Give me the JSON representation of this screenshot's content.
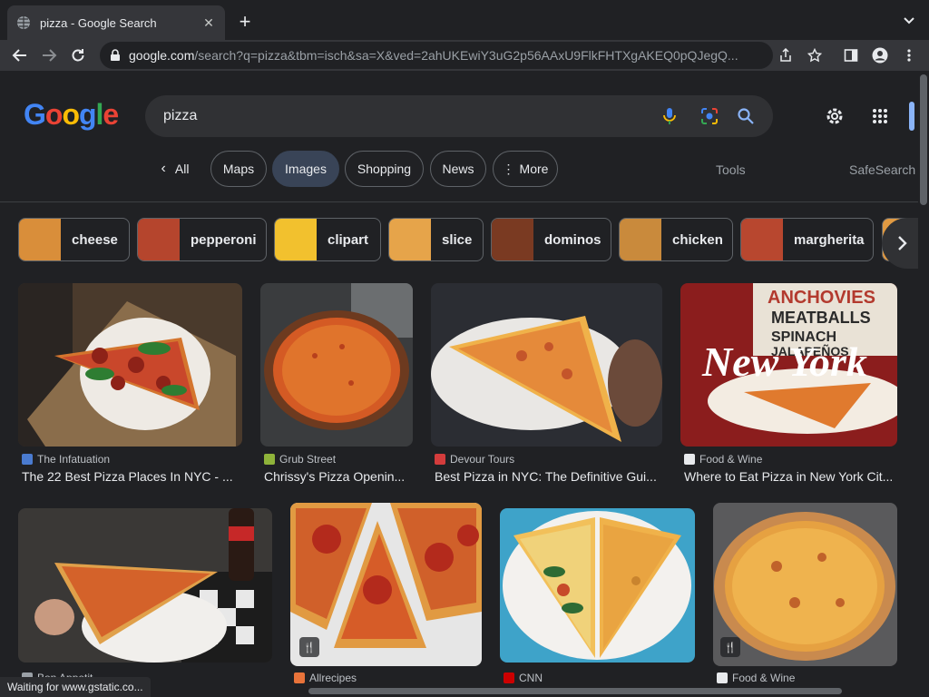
{
  "browser": {
    "tab_title": "pizza - Google Search",
    "url_host": "google.com",
    "url_path": "/search?q=pizza&tbm=isch&sa=X&ved=2ahUKEwiY3uG2p56AAxU9FlkFHTXgAKEQ0pQJegQ..."
  },
  "google": {
    "logo_letters": [
      "G",
      "o",
      "o",
      "g",
      "l",
      "e"
    ],
    "query": "pizza"
  },
  "nav": {
    "all": "All",
    "maps": "Maps",
    "images": "Images",
    "shopping": "Shopping",
    "news": "News",
    "more": "More",
    "tools": "Tools",
    "safesearch": "SafeSearch"
  },
  "related": [
    {
      "label": "cheese",
      "thumb": "#d98e3a"
    },
    {
      "label": "pepperoni",
      "thumb": "#b5452d"
    },
    {
      "label": "clipart",
      "thumb": "#f2c12e"
    },
    {
      "label": "slice",
      "thumb": "#e6a44a"
    },
    {
      "label": "dominos",
      "thumb": "#7a3a22"
    },
    {
      "label": "chicken",
      "thumb": "#c98a3c"
    },
    {
      "label": "margherita",
      "thumb": "#b8472f"
    }
  ],
  "results": [
    {
      "source": "The Infatuation",
      "title": "The 22 Best Pizza Places In NYC - ...",
      "fav": "#4a7bd0"
    },
    {
      "source": "Grub Street",
      "title": "Chrissy's Pizza Openin...",
      "fav": "#8fb33a"
    },
    {
      "source": "Devour Tours",
      "title": "Best Pizza in NYC: The Definitive Gui...",
      "fav": "#d43c3c"
    },
    {
      "source": "Food & Wine",
      "title": "Where to Eat Pizza in New York Cit...",
      "fav": "#e8eaed"
    },
    {
      "source": "Bon Appetit",
      "title": "",
      "fav": "#9aa0a6"
    },
    {
      "source": "Allrecipes",
      "title": "",
      "fav": "#e8733a"
    },
    {
      "source": "CNN",
      "title": "",
      "fav": "#cc0000"
    },
    {
      "source": "Food & Wine",
      "title": "",
      "fav": "#e8eaed"
    }
  ],
  "image_text": {
    "sign": "ANCHOVIES MEATBALLS SPINACH JALAPEÑOS",
    "new_york": "New York"
  },
  "status": "Waiting for www.gstatic.co..."
}
